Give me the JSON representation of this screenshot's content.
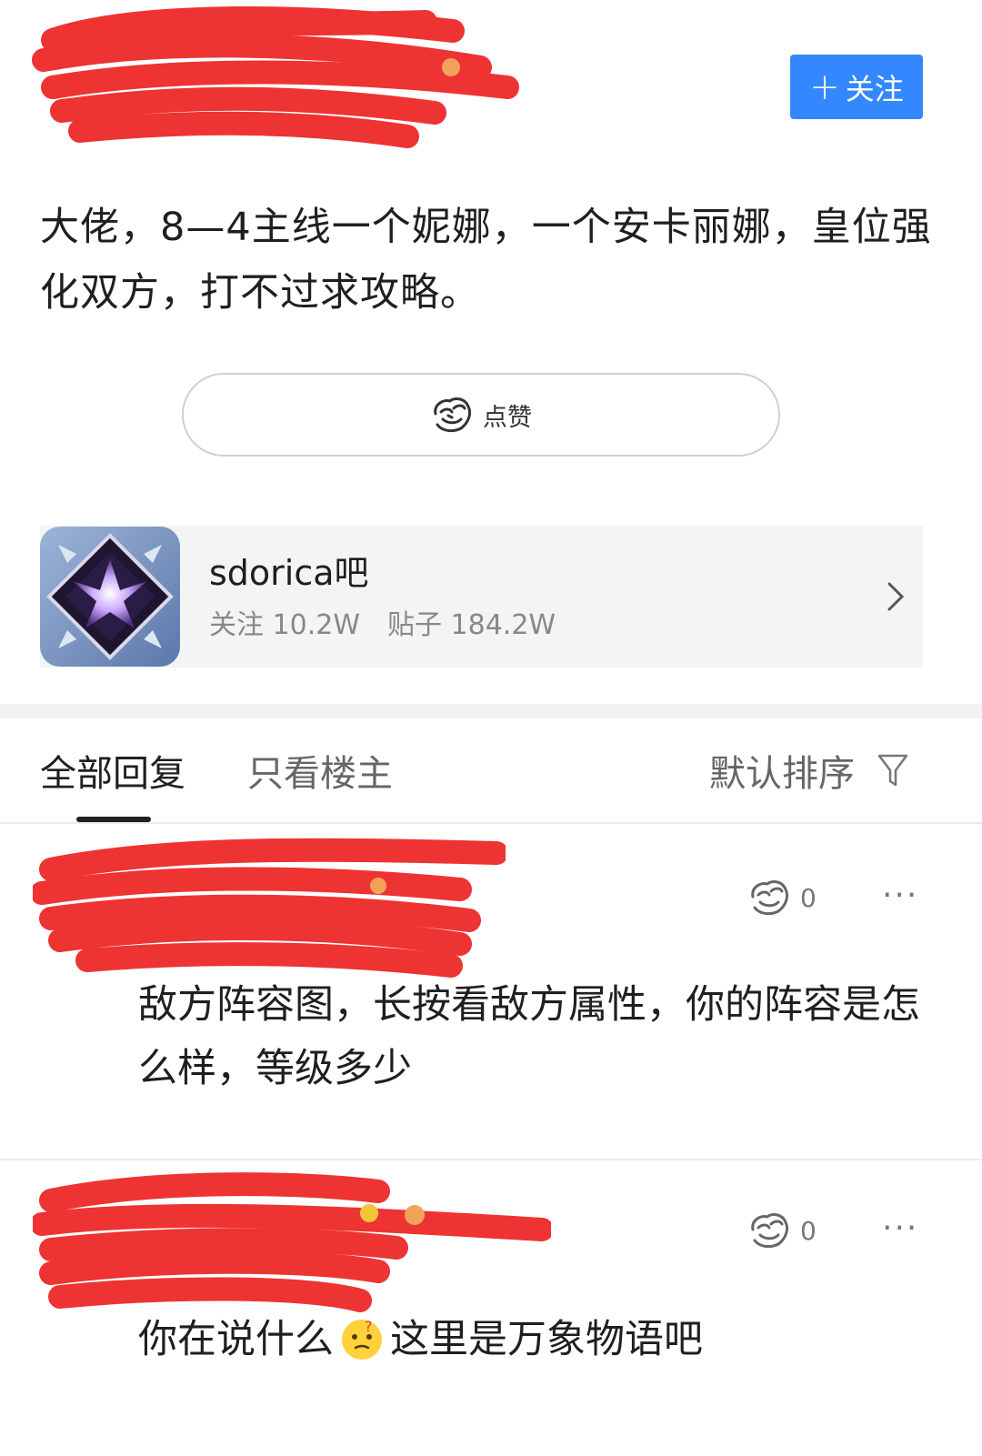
{
  "header": {
    "follow_label": "关注",
    "follow_plus": "+",
    "follow_color": "#3388ff",
    "redaction_color": "#ee3333"
  },
  "post": {
    "text": "大佬，8—4主线一个妮娜，一个安卡丽娜，皇位强化双方，打不过求攻略。",
    "like_label": "点赞",
    "like_icon": "thumbs-up-icon"
  },
  "forum": {
    "name": "sdorica吧",
    "follow_count": "关注 10.2W",
    "post_count": "贴子 184.2W",
    "avatar_icon": "sdorica-logo",
    "chevron_icon": "chevron-right-icon"
  },
  "tabs": {
    "all": "全部回复",
    "owner_only": "只看楼主",
    "sort": "默认排序",
    "sort_icon": "filter-icon"
  },
  "replies": [
    {
      "like_count": "0",
      "more": "···",
      "text": "敌方阵容图，长按看敌方属性，你的阵容是怎么样，等级多少"
    },
    {
      "like_count": "0",
      "more": "···",
      "text_before": "你在说什么",
      "emoji_icon": "thinking-emoji-icon",
      "text_after": "这里是万象物语吧"
    }
  ]
}
